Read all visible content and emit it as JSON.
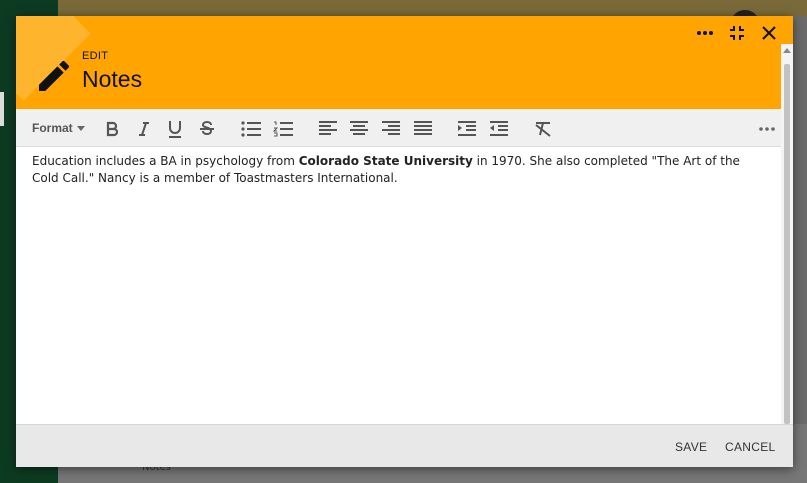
{
  "background": {
    "note_label": "Notes"
  },
  "dialog": {
    "header": {
      "subtitle": "EDIT",
      "title": "Notes",
      "accent_color": "#ffa400"
    },
    "toolbar": {
      "format_label": "Format",
      "buttons": [
        "bold-icon",
        "italic-icon",
        "underline-icon",
        "strikethrough-icon",
        "bullet-list-icon",
        "numbered-list-icon",
        "align-left-icon",
        "align-center-icon",
        "align-right-icon",
        "align-justify-icon",
        "indent-icon",
        "outdent-icon",
        "clear-format-icon",
        "more-icon"
      ]
    },
    "content": {
      "p1_a": "Education includes a BA in psychology from ",
      "p1_bold": "Colorado State University",
      "p1_b": " in 1970. She also completed \"The Art of the Cold Call.\" Nancy is a member of Toastmasters International."
    },
    "footer": {
      "save_label": "SAVE",
      "cancel_label": "CANCEL"
    }
  }
}
